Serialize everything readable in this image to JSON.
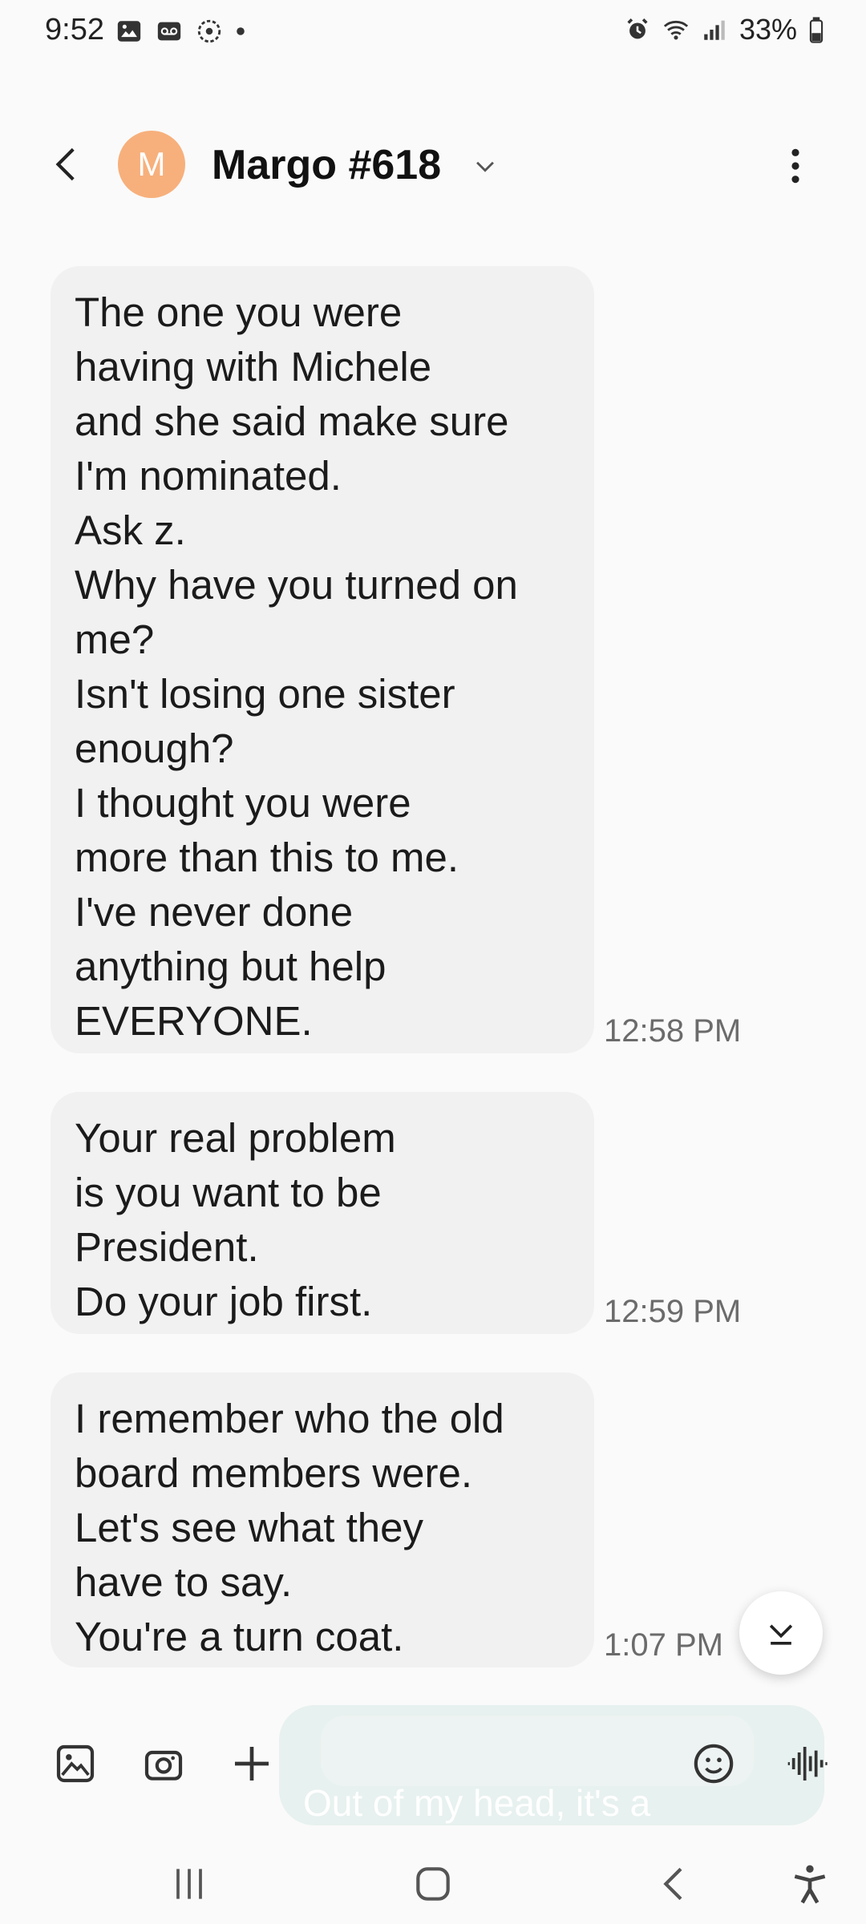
{
  "status_bar": {
    "time": "9:52",
    "battery": "33%"
  },
  "header": {
    "avatar_letter": "M",
    "contact_name": "Margo #618"
  },
  "messages": [
    {
      "text": "The one you were\nhaving with Michele\nand she said make sure\nI'm nominated.\nAsk z.\nWhy have you turned on\nme?\nIsn't losing one sister\nenough?\nI thought you were\nmore than this to me.\nI've never done\nanything but help\nEVERYONE.",
      "time": "12:58 PM"
    },
    {
      "text": "Your real problem\nis you want to be\nPresident.\nDo your job first.",
      "time": "12:59 PM"
    },
    {
      "text": "I remember who the old\nboard members were.\nLet's see what they\nhave to say.\nYou're a turn coat.",
      "time": "1:07 PM"
    }
  ],
  "composer": {
    "draft_fragment": "Out of my head, it's a"
  },
  "colors": {
    "avatar": "#f7b07c",
    "bubble": "#f1f1f1",
    "composer": "#e7f1ef"
  }
}
